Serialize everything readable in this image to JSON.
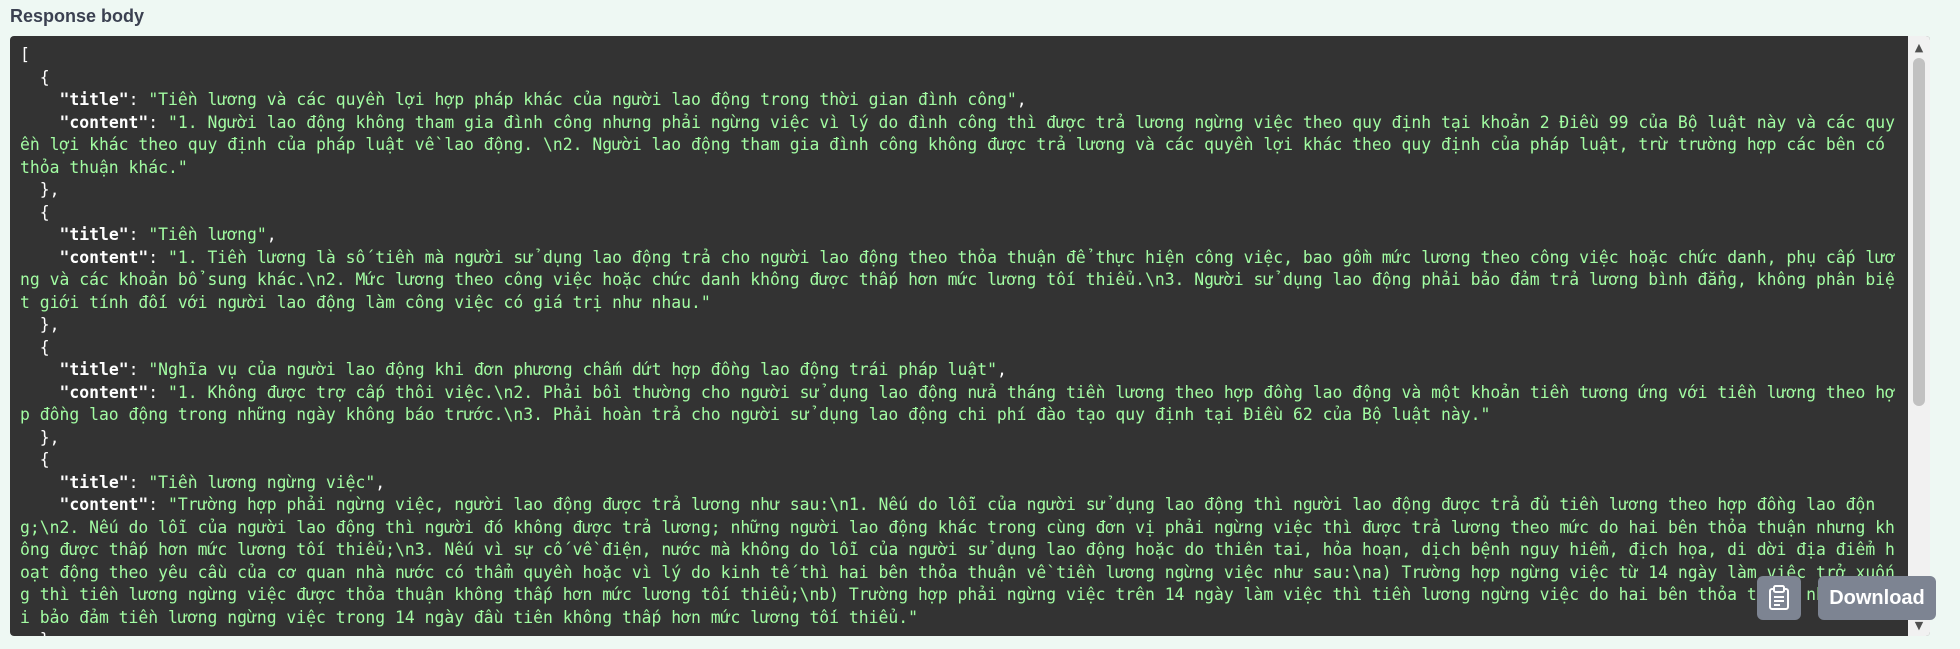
{
  "section": {
    "label": "Response body"
  },
  "response": {
    "items": [
      {
        "title": "Tiền lương và các quyền lợi hợp pháp khác của người lao động trong thời gian đình công",
        "content": "1. Người lao động không tham gia đình công nhưng phải ngừng việc vì lý do đình công thì được trả lương ngừng việc theo quy định tại khoản 2 Điều 99 của Bộ luật này và các quyền lợi khác theo quy định của pháp luật về lao động. \\n2. Người lao động tham gia đình công không được trả lương và các quyền lợi khác theo quy định của pháp luật, trừ trường hợp các bên có thỏa thuận khác."
      },
      {
        "title": "Tiền lương",
        "content": "1. Tiền lương là số tiền mà người sử dụng lao động trả cho người lao động theo thỏa thuận để thực hiện công việc, bao gồm mức lương theo công việc hoặc chức danh, phụ cấp lương và các khoản bổ sung khác.\\n2. Mức lương theo công việc hoặc chức danh không được thấp hơn mức lương tối thiểu.\\n3. Người sử dụng lao động phải bảo đảm trả lương bình đẳng, không phân biệt giới tính đối với người lao động làm công việc có giá trị như nhau."
      },
      {
        "title": "Nghĩa vụ của người lao động khi đơn phương chấm dứt hợp đồng lao động trái pháp luật",
        "content": "1. Không được trợ cấp thôi việc.\\n2. Phải bồi thường cho người sử dụng lao động nửa tháng tiền lương theo hợp đồng lao động và một khoản tiền tương ứng với tiền lương theo hợp đồng lao động trong những ngày không báo trước.\\n3. Phải hoàn trả cho người sử dụng lao động chi phí đào tạo quy định tại Điều 62 của Bộ luật này."
      },
      {
        "title": "Tiền lương ngừng việc",
        "content": "Trường hợp phải ngừng việc, người lao động được trả lương như sau:\\n1. Nếu do lỗi của người sử dụng lao động thì người lao động được trả đủ tiền lương theo hợp đồng lao động;\\n2. Nếu do lỗi của người lao động thì người đó không được trả lương; những người lao động khác trong cùng đơn vị phải ngừng việc thì được trả lương theo mức do hai bên thỏa thuận nhưng không được thấp hơn mức lương tối thiểu;\\n3. Nếu vì sự cố về điện, nước mà không do lỗi của người sử dụng lao động hoặc do thiên tai, hỏa hoạn, dịch bệnh nguy hiểm, địch họa, di dời địa điểm hoạt động theo yêu cầu của cơ quan nhà nước có thẩm quyền hoặc vì lý do kinh tế thì hai bên thỏa thuận về tiền lương ngừng việc như sau:\\na) Trường hợp ngừng việc từ 14 ngày làm việc trở xuống thì tiền lương ngừng việc được thỏa thuận không thấp hơn mức lương tối thiểu;\\nb) Trường hợp phải ngừng việc trên 14 ngày làm việc thì tiền lương ngừng việc do hai bên thỏa thuận nhưng phải bảo đảm tiền lương ngừng việc trong 14 ngày đầu tiên không thấp hơn mức lương tối thiểu."
      }
    ]
  },
  "actions": {
    "copy_icon": "clipboard-icon",
    "download_label": "Download"
  },
  "scrollbar": {
    "up_icon": "chevron-up-icon",
    "down_icon": "chevron-down-icon"
  },
  "colors": {
    "panel_bg": "#333333",
    "string": "#a2fca2",
    "key": "#ffffff",
    "button_bg": "#7d8492"
  }
}
